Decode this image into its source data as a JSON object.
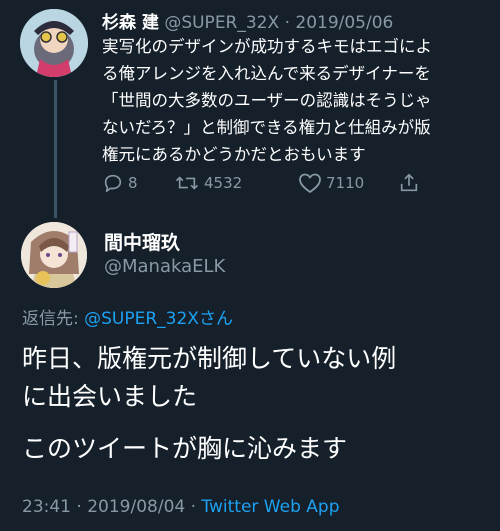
{
  "tweet1": {
    "display_name": "杉森 建",
    "handle": "@SUPER_32X",
    "separator": "·",
    "date": "2019/05/06",
    "lines": [
      "実写化のデザインが成功するキモはエゴによ",
      "る俺アレンジを入れ込んで来るデザイナーを",
      "「世間の大多数のユーザーの認識はそうじゃ",
      "ないだろ？」と制御できる権力と仕組みが版",
      "権元にあるかどうかだとおもいます"
    ],
    "replies": "8",
    "retweets": "4532",
    "likes": "7110"
  },
  "tweet2": {
    "display_name": "間中瑠玖",
    "handle": "@ManakaELK",
    "reply_prefix": "返信先:",
    "reply_handle": "@SUPER_32Xさん",
    "paragraph1_line1": "昨日、版権元が制御していない例",
    "paragraph1_line2": "に出会いました",
    "paragraph2": "このツイートが胸に沁みます",
    "time": "23:41",
    "separator": "·",
    "date": "2019/08/04",
    "separator2": "·",
    "app": "Twitter Web App"
  },
  "colors": {
    "background": "#15202b",
    "muted": "#8899a6",
    "link": "#1da1f2",
    "thread_line": "#3d5466"
  },
  "icons": [
    "reply-icon",
    "retweet-icon",
    "like-icon",
    "share-icon"
  ]
}
